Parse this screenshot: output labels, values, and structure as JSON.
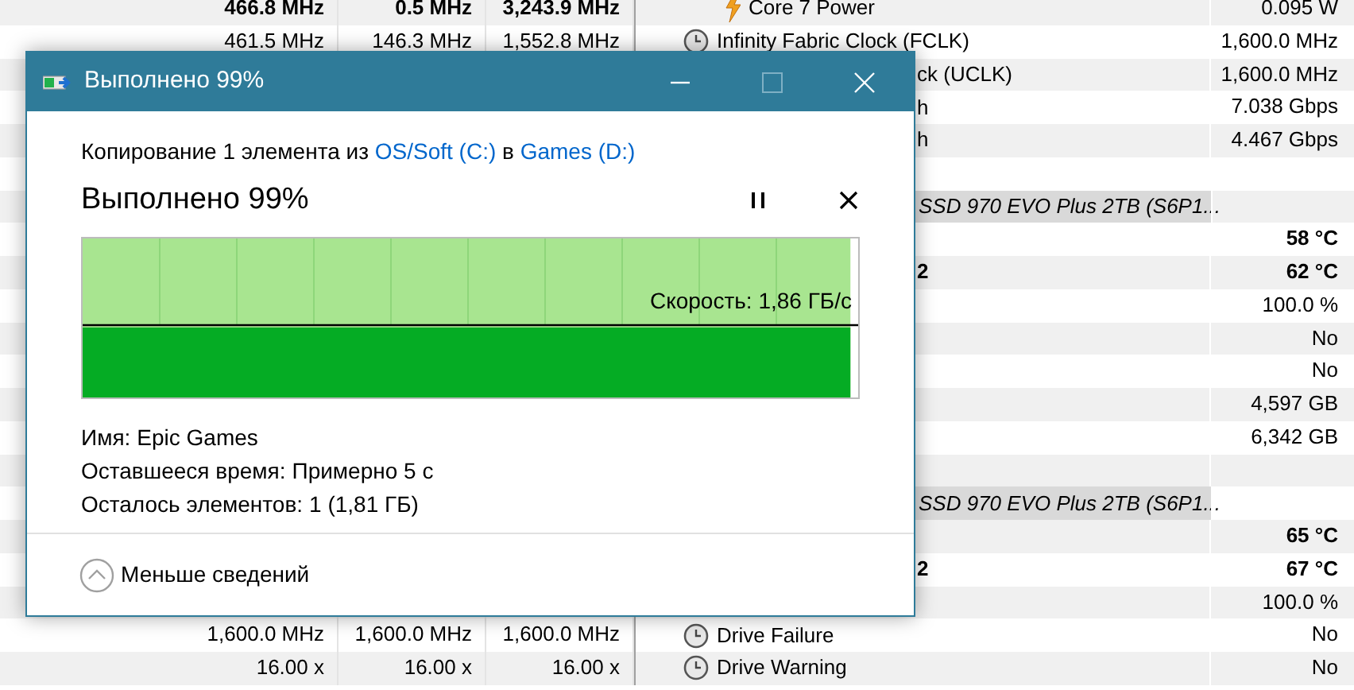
{
  "sensor_rows": [
    {
      "kind": "power",
      "label": "Core 7 Power",
      "value": "0.095 W",
      "bold": false,
      "left": [
        "466.8 MHz",
        "0.5 MHz",
        "3,243.9 MHz"
      ],
      "left_bold": true
    },
    {
      "kind": "clock",
      "label": "Infinity Fabric Clock (FCLK)",
      "value": "1,600.0 MHz",
      "bold": false,
      "left": [
        "461.5 MHz",
        "146.3 MHz",
        "1,552.8 MHz"
      ],
      "left_bold": false
    },
    {
      "kind": "clipped",
      "label": "ck (UCLK)",
      "value": "1,600.0 MHz",
      "bold": false
    },
    {
      "kind": "clipped",
      "label": "h",
      "value": "7.038 Gbps",
      "bold": false
    },
    {
      "kind": "clipped",
      "label": "h",
      "value": "4.467 Gbps",
      "bold": false
    },
    {
      "kind": "blank"
    },
    {
      "kind": "header",
      "label": "SSD 970 EVO Plus 2TB (S6P1..."
    },
    {
      "kind": "clipped",
      "label": "",
      "value": "58 °C",
      "bold": true
    },
    {
      "kind": "clipped",
      "label": "2",
      "value": "62 °C",
      "bold": true
    },
    {
      "kind": "clipped",
      "label": "",
      "value": "100.0 %",
      "bold": false
    },
    {
      "kind": "clipped",
      "label": "",
      "value": "No",
      "bold": false
    },
    {
      "kind": "clipped",
      "label": "",
      "value": "No",
      "bold": false
    },
    {
      "kind": "clipped",
      "label": "",
      "value": "4,597 GB",
      "bold": false
    },
    {
      "kind": "clipped",
      "label": "",
      "value": "6,342 GB",
      "bold": false
    },
    {
      "kind": "blank"
    },
    {
      "kind": "header",
      "label": "SSD 970 EVO Plus 2TB (S6P1..."
    },
    {
      "kind": "clipped",
      "label": "",
      "value": "65 °C",
      "bold": true
    },
    {
      "kind": "clipped",
      "label": "2",
      "value": "67 °C",
      "bold": true
    },
    {
      "kind": "clipped",
      "label": "",
      "value": "100.0 %",
      "bold": false
    },
    {
      "kind": "clock",
      "label": "Drive Failure",
      "value": "No",
      "bold": false,
      "left": [
        "1,600.0 MHz",
        "1,600.0 MHz",
        "1,600.0 MHz"
      ],
      "left_bold": false
    },
    {
      "kind": "clock",
      "label": "Drive Warning",
      "value": "No",
      "bold": false,
      "left": [
        "16.00 x",
        "16.00 x",
        "16.00 x"
      ],
      "left_bold": false
    }
  ],
  "dialog": {
    "title": "Выполнено 99%",
    "summary": "Копирование 1 элемента из ",
    "source": "OS/Soft (C:)",
    "joiner": " в ",
    "target": "Games (D:)",
    "heading": "Выполнено 99%",
    "progress": {
      "level": 0.99,
      "speed": "Скорость: 1,86 ГБ/с"
    },
    "details": [
      {
        "label": "Имя:",
        "value": "Epic Games"
      },
      {
        "label": "Оставшееся время:",
        "value": "Примерно 5 с"
      },
      {
        "label": "Осталось элементов:",
        "value": "1 (1,81 ГБ)"
      }
    ],
    "toggle": "Меньше сведений"
  }
}
